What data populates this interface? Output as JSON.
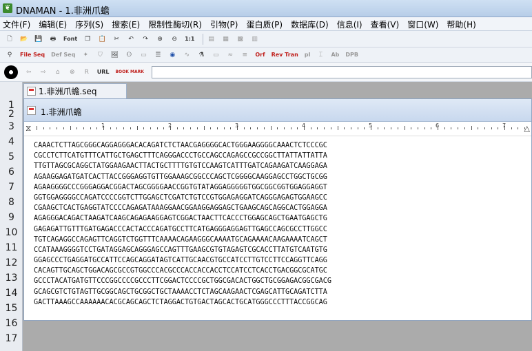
{
  "window": {
    "title": "DNAMAN - 1.非洲爪蟾"
  },
  "menubar": {
    "items": [
      {
        "label": "文件(F)"
      },
      {
        "label": "编辑(E)"
      },
      {
        "label": "序列(S)"
      },
      {
        "label": "搜索(E)"
      },
      {
        "label": "限制性酶切(R)"
      },
      {
        "label": "引物(P)"
      },
      {
        "label": "蛋白质(P)"
      },
      {
        "label": "数据库(D)"
      },
      {
        "label": "信息(I)"
      },
      {
        "label": "查看(V)"
      },
      {
        "label": "窗口(W)"
      },
      {
        "label": "帮助(H)"
      }
    ]
  },
  "toolbar1": {
    "font_label": "Font",
    "zoom_label": "1:1"
  },
  "toolbar2": {
    "file_seq_label": "File Seq",
    "def_seq_label": "Def Seq",
    "orf_label": "Orf",
    "rev_tran_label": "Rev Tran",
    "pi_label": "pI",
    "ab_label": "Ab",
    "dpb_label": "DPB"
  },
  "toolbar3": {
    "r_label": "R",
    "url_label": "URL",
    "book_label": "BOOK MARK",
    "address_value": ""
  },
  "line_numbers": [
    "1",
    "2",
    "3",
    "4",
    "5",
    "6",
    "7",
    "8",
    "9",
    "10",
    "11",
    "12",
    "13",
    "14",
    "15",
    "16",
    "17"
  ],
  "file_tab": {
    "label": "1.非洲爪蟾.seq"
  },
  "document": {
    "title": "1.非洲爪蟾",
    "ruler_marks": [
      "1",
      "2",
      "3",
      "4",
      "5",
      "6",
      "7"
    ],
    "sequence_lines": [
      "CAAACTCTTAGCGGGCAGGAGGGACACAGATCTCTAACGAGGGGCACTGGGAAGGGGCAAACTCTCCCGC",
      "CGCCTCTTCATGTTTCATTGCTGAGCTTTCAGGGACCCTGCCAGCCAGAGCCGCCGGCTTATTATTATTA",
      "TTGTTAGCGCAGGCTATGGAAGAACTTACTGCTTTTGTGTCCAAGTCATTTGATCAGAAGATCAAGGAGA",
      "AGAAGGAGATGATCACTTACCGGGAGGTGTTGGAAAGCGGCCCAGCTCGGGGCAAGGAGCCTGGCTGCGG",
      "AGAAGGGGCCCGGGAGGACGGACTAGCGGGGAACCGGTGTATAGGAGGGGGTGGCGGCGGTGGAGGAGGT",
      "GGTGGAGGGGCCAGATCCCCGGTCTTGGAGCTCGATCTGTCCGTGGAGAGGATCAGGGAGAGTGGAAGCC",
      "CGAAGCTCACTGAGGTATCCCCAGAGATAAAGGAACGGAAGGAGGAGCTGAAGCAGCAGGCACTGGAGGA",
      "AGAGGGACAGACTAAGATCAAGCAGAGAAGGAGTCGGACTAACTTCACCCTGGAGCAGCTGAATGAGCTG",
      "GAGAGATTGTTTGATGAGACCCACTACCCAGATGCCTTCATGAGGGAGGAGTTGAGCCAGCGCCTTGGCC",
      "TGTCAGAGGCCAGAGTTCAGGTCTGGTTTCAAAACAGAAGGGCAAAATGCAGAAAACAAGAAAATCAGCT",
      "CCATAAAGGGGTCCTGATAGGAGCAGGGAGCCAGTTTGAAGCGTGTAGAGTCGCACCTTATGTCAATGTG",
      "GGAGCCCTGAGGATGCCATTCCAGCAGGATAGTCATTGCAACGTGCCATCCTTGTCCTTCCAGGTTCAGG",
      "CACAGTTGCAGCTGGACAGCGCCGTGGCCCACGCCCACCACCACCTCCATCCTCACCTGACGGCGCATGC",
      "GCCCTACATGATGTTCCCGGCCCCGCCCTTCGGACTCCCCGCTGGCGACACTGGCTGCGGAGACGGCGACG",
      "GCAGCGTCTGTAGTTGCGGCAGCTGCGGCTGCTAAAACCTCTAGCAAGAACTCGAGCATTGCAGATCTTA",
      "GACTTAAAGCCAAAAAACACGCAGCAGCTCTAGGACTGTGACTAGCACTGCATGGGCCCTTTACCGGCAG"
    ]
  }
}
